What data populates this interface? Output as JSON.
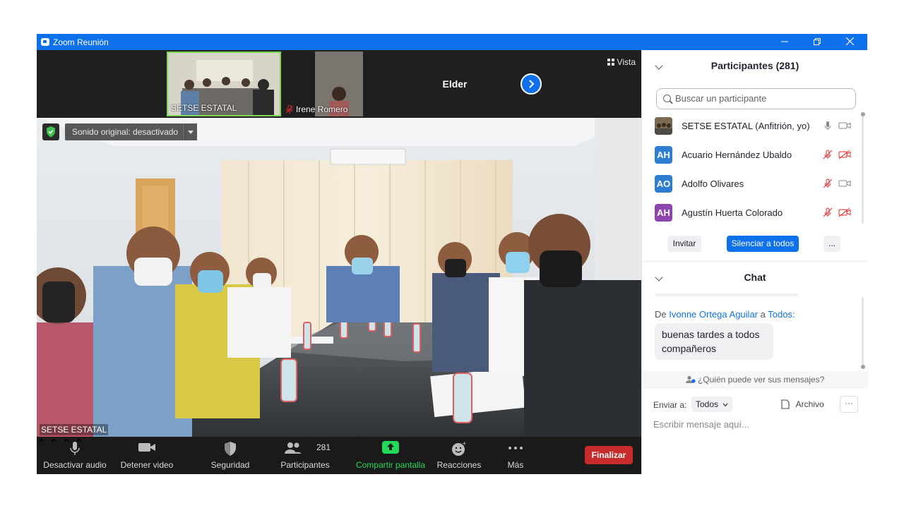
{
  "window": {
    "title": "Zoom Reunión"
  },
  "thumbnails": [
    {
      "name": "SETSE ESTATAL",
      "muted": false
    },
    {
      "name": "Irene Romero",
      "muted": true
    },
    {
      "name": "",
      "muted": true
    },
    {
      "name": "Elder",
      "muted": false
    }
  ],
  "view_label": "Vista",
  "main_video": {
    "original_sound": "Sonido original: desactivado",
    "speaker_name": "SETSE ESTATAL"
  },
  "toolbar": {
    "mute": "Desactivar audio",
    "video": "Detener video",
    "security": "Seguridad",
    "participants": "Participantes",
    "participants_count": "281",
    "share": "Compartir pantalla",
    "reactions": "Reacciones",
    "more": "Más",
    "end": "Finalizar"
  },
  "participants_panel": {
    "title": "Participantes (281)",
    "search_placeholder": "Buscar un participante",
    "participants": [
      {
        "initials": "",
        "name": "SETSE ESTATAL (Anfitrión, yo)",
        "color": "#6b5a45",
        "mic_muted": false,
        "cam_off": false
      },
      {
        "initials": "AH",
        "name": "Acuario Hernández Ubaldo",
        "color": "#2d7dd2",
        "mic_muted": true,
        "cam_off": true
      },
      {
        "initials": "AO",
        "name": "Adolfo Olivares",
        "color": "#2d7dd2",
        "mic_muted": true,
        "cam_off": false
      },
      {
        "initials": "AH",
        "name": "Agustín Huerta Colorado",
        "color": "#8e44ad",
        "mic_muted": true,
        "cam_off": true
      }
    ],
    "invite": "Invitar",
    "mute_all": "Silenciar a todos",
    "more": "..."
  },
  "chat": {
    "title": "Chat",
    "from_prefix": "De",
    "sender": "Ivonne Ortega Aguilar",
    "to_word": "a",
    "recipient": "Todos:",
    "message": "buenas tardes a todos compañeros",
    "who_sees": "¿Quién puede ver sus mensajes?",
    "send_to_label": "Enviar a:",
    "send_to_value": "Todos",
    "file_label": "Archivo",
    "more": "···",
    "input_placeholder": "Escribir mensaje aquí..."
  },
  "colors": {
    "zoom_blue": "#0e71eb",
    "end_red": "#c72b2b",
    "share_green": "#23d959",
    "mute_red": "#e02828"
  }
}
